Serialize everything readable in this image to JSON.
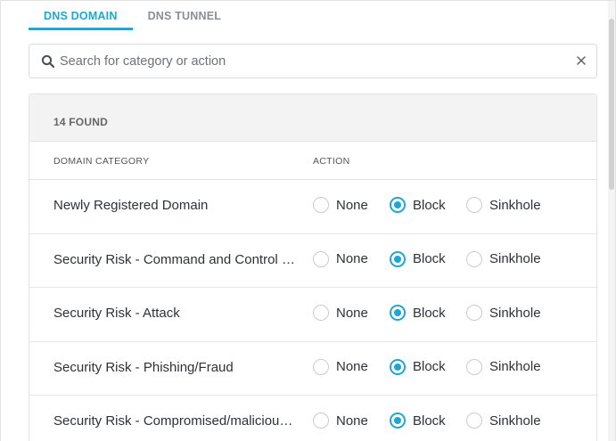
{
  "tabs": [
    {
      "label": "DNS DOMAIN",
      "active": true
    },
    {
      "label": "DNS TUNNEL",
      "active": false
    }
  ],
  "search": {
    "placeholder": "Search for category or action",
    "value": "",
    "icon": "search-icon",
    "clear_icon": "close-icon"
  },
  "results": {
    "found_label": "14 FOUND"
  },
  "table": {
    "columns": [
      "DOMAIN CATEGORY",
      "ACTION"
    ],
    "options": [
      "None",
      "Block",
      "Sinkhole"
    ],
    "rows": [
      {
        "category": "Newly Registered Domain",
        "selected": "Block"
      },
      {
        "category": "Security Risk - Command and Control s...",
        "selected": "Block"
      },
      {
        "category": "Security Risk - Attack",
        "selected": "Block"
      },
      {
        "category": "Security Risk - Phishing/Fraud",
        "selected": "Block"
      },
      {
        "category": "Security Risk - Compromised/malicious ...",
        "selected": "Block"
      }
    ]
  },
  "colors": {
    "accent": "#1ea7d2",
    "header_bg": "#f3f3f3",
    "border": "#e0e2e4"
  }
}
